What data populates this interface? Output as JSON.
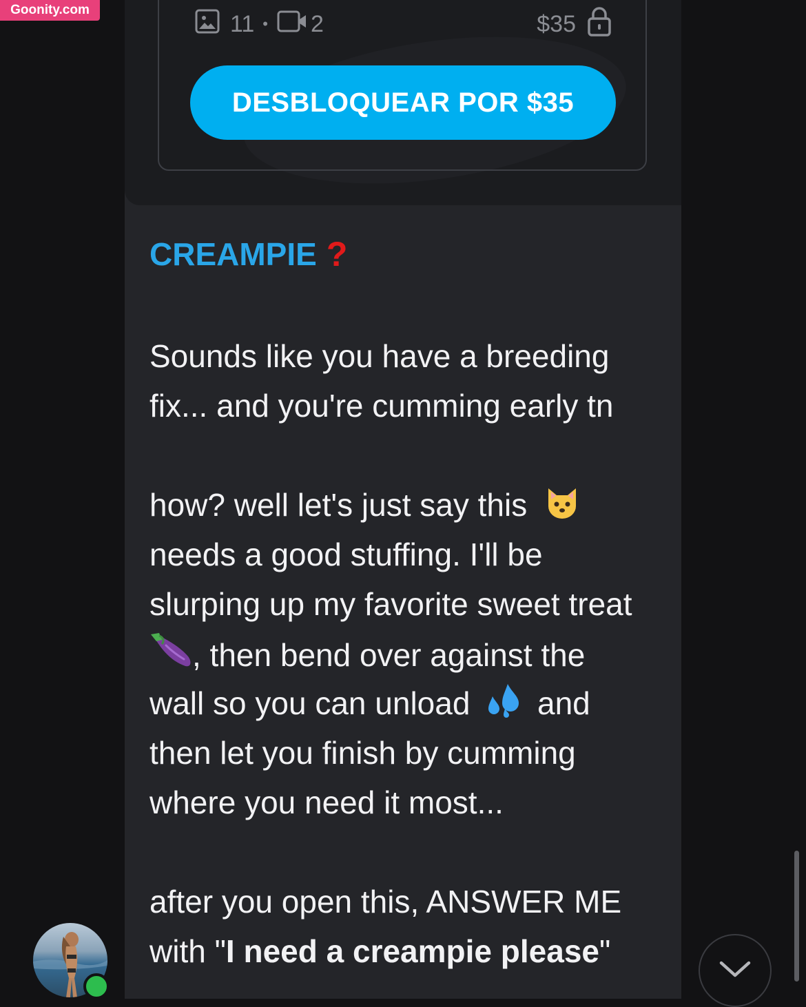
{
  "watermark": "Goonity.com",
  "locked_post": {
    "images_count": "11",
    "separator": "•",
    "videos_count": "2",
    "price": "$35",
    "unlock_button": "DESBLOQUEAR POR $35"
  },
  "message": {
    "title": "CREAMPIE",
    "title_icon": "red-question-mark-icon",
    "line1": "Sounds like you have a breeding",
    "line2": "fix... and you're cumming early tn",
    "line3": "how? well let's just say this",
    "line4": "needs a good stuffing. I'll be",
    "line5": "slurping up my favorite sweet treat",
    "line6": ", then bend over against the",
    "line7a": "wall so you can unload",
    "line7b": "and",
    "line8": "then let you finish by cumming",
    "line9": "where you need it most...",
    "line10": "after you open this, ANSWER ME",
    "line11_prefix": "with \"",
    "line11_bold": "I need a creampie please",
    "line11_suffix": "\""
  },
  "colors": {
    "accent": "#00aff0",
    "title": "#2aa6e8",
    "question": "#e11a1a",
    "watermark": "#e8407a",
    "online": "#2dbd4e"
  }
}
